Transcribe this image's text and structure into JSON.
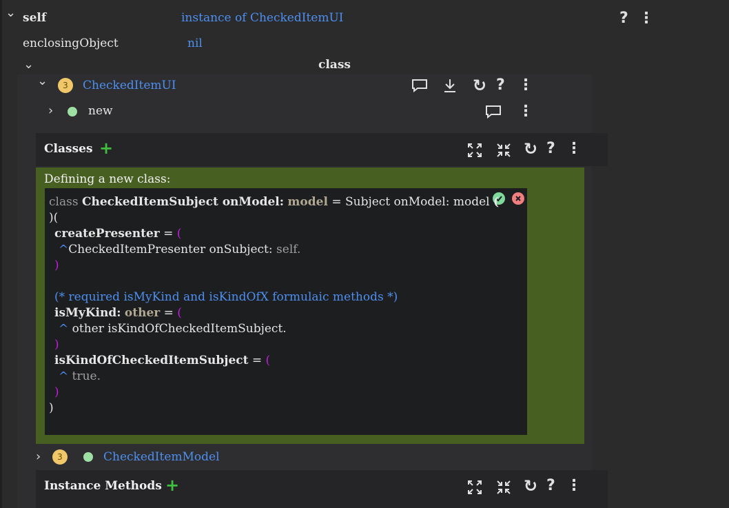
{
  "self_row": {
    "label": "self",
    "value": "instance of CheckedItemUI"
  },
  "enclosing_row": {
    "label": "enclosingObject",
    "value": "nil"
  },
  "class_header": "class",
  "class_node": {
    "badge": "3",
    "name": "CheckedItemUI"
  },
  "new_node": {
    "name": "new"
  },
  "classes_section": {
    "title": "Classes"
  },
  "defining_label": "Defining a new class:",
  "code": {
    "l1_kw": "class",
    "l1_name": "CheckedItemSubject onModel:",
    "l1_arg": "model",
    "l1_rest": "= Subject onModel: model",
    "l1_paren": "(",
    "l2": ")(",
    "l3_name": "createPresenter",
    "l3_eq": " = ",
    "l3_paren": "(",
    "l4_caret": "^",
    "l4_text": "CheckedItemPresenter onSubject: ",
    "l4_self": "self.",
    "l5_paren": ")",
    "l6_comment": "(* required isMyKind and isKindOfX formulaic methods *)",
    "l7_name": "isMyKind:",
    "l7_arg": "other",
    "l7_eq": " = ",
    "l7_paren": "(",
    "l8_caret": "^",
    "l8_text": " other isKindOfCheckedItemSubject.",
    "l9_paren": ")",
    "l10_name": "isKindOfCheckedItemSubject",
    "l10_eq": " = ",
    "l10_paren": "(",
    "l11_caret": "^",
    "l11_text": " true.",
    "l12_paren": ")",
    "l13": ")"
  },
  "model_node": {
    "badge": "3",
    "name": "CheckedItemModel"
  },
  "instance_section": {
    "title": "Instance Methods"
  },
  "colors": {
    "link": "#4d8ff0",
    "green_panel": "#485f22",
    "accept": "#7fd99a",
    "cancel": "#f08080",
    "plus": "#3fbf3f",
    "badge": "#f0c86a",
    "paren": "#c21de0"
  },
  "icons": [
    "chevron-down-icon",
    "chevron-right-icon",
    "help-icon",
    "more-vert-icon",
    "comment-icon",
    "download-icon",
    "refresh-icon",
    "expand-icon",
    "collapse-icon",
    "plus-icon",
    "accept-icon",
    "cancel-icon",
    "status-dot-icon"
  ]
}
